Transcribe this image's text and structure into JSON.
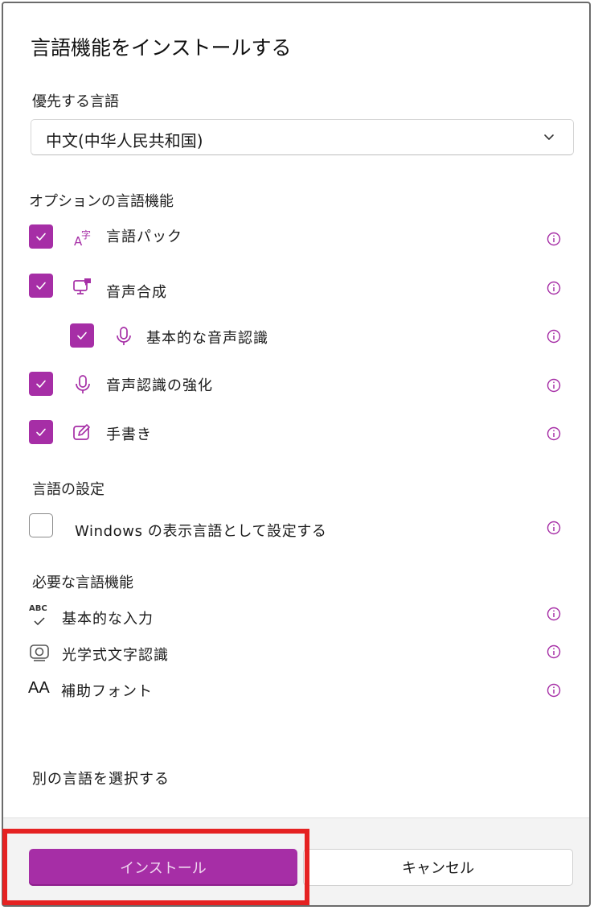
{
  "dialog": {
    "title": "言語機能をインストールする",
    "preferred_language_label": "優先する言語",
    "preferred_language_value": "中文(中华人民共和国)",
    "optional_section_label": "オプションの言語機能",
    "optional_features": [
      {
        "label": "言語パック",
        "checked": true,
        "icon": "language-pack-icon"
      },
      {
        "label": "音声合成",
        "checked": true,
        "icon": "text-to-speech-icon"
      },
      {
        "label": "基本的な音声認識",
        "checked": true,
        "icon": "microphone-icon"
      },
      {
        "label": "音声認識の強化",
        "checked": true,
        "icon": "microphone-icon"
      },
      {
        "label": "手書き",
        "checked": true,
        "icon": "handwriting-icon"
      }
    ],
    "settings_section_label": "言語の設定",
    "display_language_option": {
      "label": "Windows の表示言語として設定する",
      "checked": false
    },
    "required_section_label": "必要な言語機能",
    "required_features": [
      {
        "label": "基本的な入力",
        "icon": "abc-check-icon",
        "icon_text": "ABC"
      },
      {
        "label": "光学式文字認識",
        "icon": "ocr-camera-icon"
      },
      {
        "label": "補助フォント",
        "icon": "font-aa-icon",
        "icon_text": "AA"
      }
    ],
    "choose_other_language_link": "別の言語を選択する",
    "install_button": "インストール",
    "cancel_button": "キャンセル"
  },
  "colors": {
    "accent": "#a62ea6",
    "highlight": "#e52222"
  }
}
